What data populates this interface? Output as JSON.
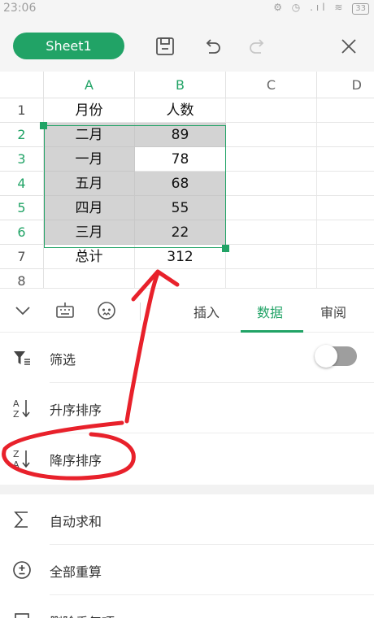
{
  "status_bar": {
    "time": "23:06",
    "icons": "⚙ ◷ .ıl ≋",
    "battery": "33"
  },
  "title_bar": {
    "sheet_tab": "Sheet1"
  },
  "spreadsheet": {
    "columns": [
      "A",
      "B",
      "C",
      "D"
    ],
    "rows": [
      "1",
      "2",
      "3",
      "4",
      "5",
      "6",
      "7",
      "8"
    ],
    "cells": {
      "A1": "月份",
      "B1": "人数",
      "A2": "二月",
      "B2": "89",
      "A3": "一月",
      "B3": "78",
      "A4": "五月",
      "B4": "68",
      "A5": "四月",
      "B5": "55",
      "A6": "三月",
      "B6": "22",
      "A7": "总计",
      "B7": "312"
    }
  },
  "ribbon": {
    "tabs": [
      "插入",
      "数据",
      "审阅"
    ],
    "active_tab": "数据"
  },
  "menu": {
    "items": [
      "筛选",
      "升序排序",
      "降序排序",
      "自动求和",
      "全部重算",
      "删除重复项"
    ]
  },
  "colors": {
    "accent": "#21a366",
    "annotation": "#e8212b",
    "selection_shade": "#d3d3d3"
  },
  "icons": {
    "filter": "filter-icon",
    "sort_asc": "sort-ascending-icon",
    "sort_desc": "sort-descending-icon",
    "sum": "sigma-icon",
    "recalc": "plus-minus-circle-icon",
    "dedupe": "remove-duplicates-icon"
  }
}
